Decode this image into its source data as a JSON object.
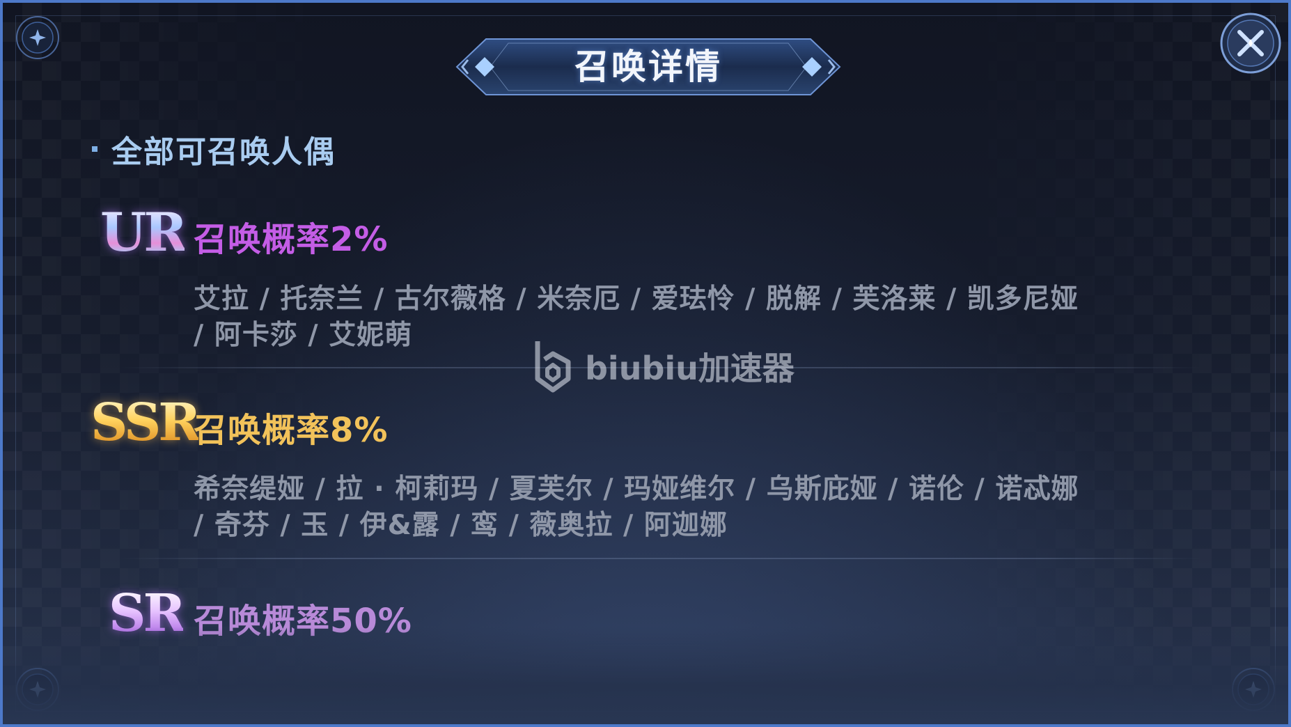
{
  "dialog": {
    "title": "召唤详情",
    "close_icon": "close-x-icon"
  },
  "section": {
    "title": "全部可召唤人偶"
  },
  "tiers": [
    {
      "badge": "UR",
      "rate_label": "召唤概率2%",
      "rate": 2,
      "color": "#c45de6",
      "names_line1": "艾拉 / 托奈兰 / 古尔薇格 / 米奈厄 / 爱珐怜 / 脱解 / 芙洛莱 / 凯多尼娅",
      "names_line2": "/ 阿卡莎 / 艾妮萌"
    },
    {
      "badge": "SSR",
      "rate_label": "召唤概率8%",
      "rate": 8,
      "color": "#f2c25a",
      "names_line1": "希奈缇娅 / 拉 · 柯莉玛 / 夏芙尔 / 玛娅维尔 / 乌斯庇娅 / 诺伦 / 诺忒娜",
      "names_line2": "/ 奇芬 / 玉 / 伊&露 / 鸾 / 薇奥拉 / 阿迦娜"
    },
    {
      "badge": "SR",
      "rate_label": "召唤概率50%",
      "rate": 50,
      "color": "#b88ad8"
    }
  ],
  "watermark": {
    "text": "biubiu加速器",
    "icon": "biubiu-logo-icon"
  }
}
